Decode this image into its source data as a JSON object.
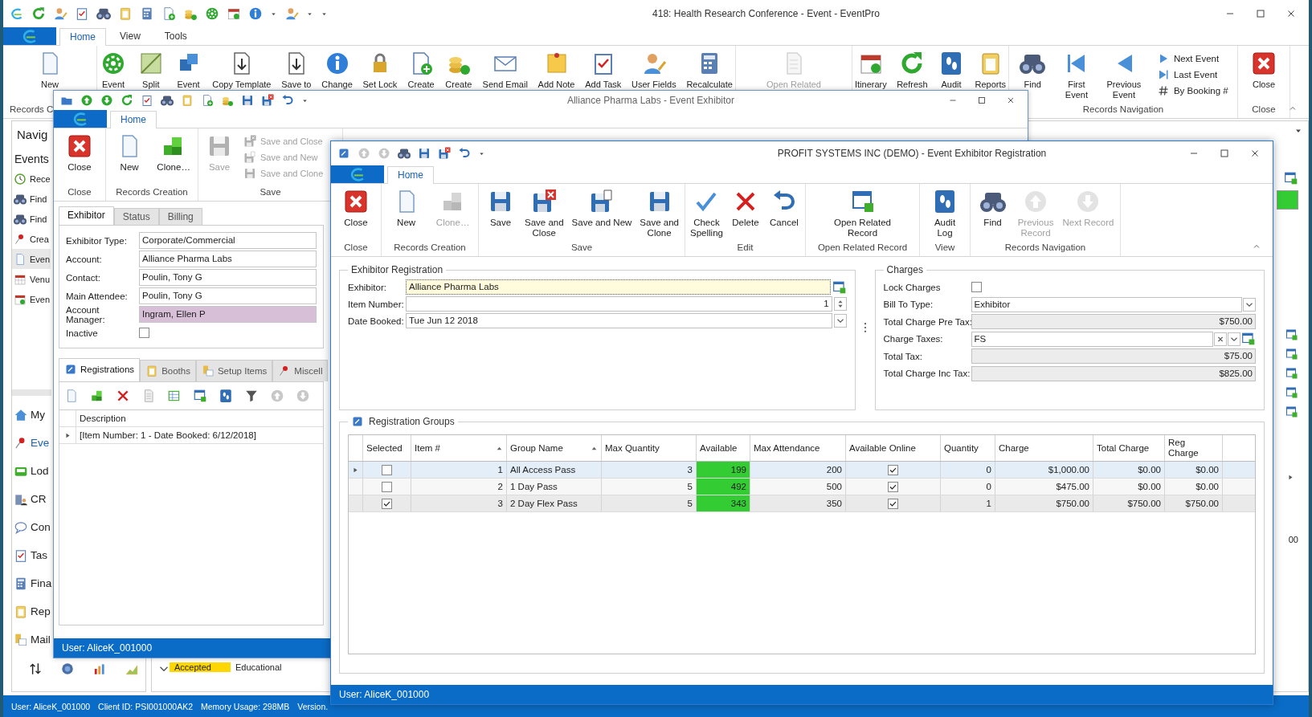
{
  "main_window": {
    "title": "418: Health Research Conference - Event - EventPro",
    "tabs": [
      {
        "label": "Home",
        "selected": true
      },
      {
        "label": "View",
        "selected": false
      },
      {
        "label": "Tools",
        "selected": false
      }
    ],
    "ribbon_groups": [
      {
        "label": "Records C",
        "buttons": [
          {
            "label": "New",
            "disabled": false
          }
        ]
      },
      {
        "buttons": [
          {
            "label": "Event",
            "disabled": false
          },
          {
            "label": "Split",
            "disabled": false
          },
          {
            "label": "Event",
            "disabled": false
          },
          {
            "label": "Copy Template",
            "disabled": false
          },
          {
            "label": "Save to",
            "disabled": false
          },
          {
            "label": "Change",
            "disabled": false
          },
          {
            "label": "Set Lock",
            "disabled": false
          },
          {
            "label": "Create",
            "disabled": false
          },
          {
            "label": "Create",
            "disabled": false
          },
          {
            "label": "Send Email",
            "disabled": false
          },
          {
            "label": "Add Note",
            "disabled": false
          },
          {
            "label": "Add Task",
            "disabled": false
          },
          {
            "label": "User Fields",
            "disabled": false
          },
          {
            "label": "Recalculate",
            "disabled": false
          }
        ]
      },
      {
        "buttons": [
          {
            "label": "Open Related",
            "disabled": true
          }
        ]
      },
      {
        "buttons": [
          {
            "label": "Itinerary",
            "disabled": false
          },
          {
            "label": "Refresh",
            "disabled": false
          },
          {
            "label": "Audit",
            "disabled": false
          },
          {
            "label": "Reports",
            "disabled": false
          }
        ]
      },
      {
        "label": "Records Navigation",
        "buttons": [
          {
            "label": "Find",
            "disabled": false
          },
          {
            "label": "First\nEvent",
            "disabled": false
          },
          {
            "label": "Previous\nEvent",
            "disabled": false
          }
        ],
        "small_buttons": [
          {
            "label": "Next Event",
            "disabled": false
          },
          {
            "label": "Last Event",
            "disabled": false
          },
          {
            "label": "By Booking #",
            "disabled": false
          }
        ]
      },
      {
        "label": "Close",
        "buttons": [
          {
            "label": "Close",
            "disabled": false
          }
        ]
      }
    ],
    "navigation": {
      "title": "Navig",
      "section": "Events",
      "items": [
        {
          "label": "Rece",
          "selected": false
        },
        {
          "label": "Find",
          "selected": false
        },
        {
          "label": "Find",
          "selected": false
        },
        {
          "label": "Crea",
          "selected": false
        },
        {
          "label": "Even",
          "selected": true
        },
        {
          "label": "Venu",
          "selected": false
        },
        {
          "label": "Even",
          "selected": false
        }
      ],
      "modules": [
        {
          "label": "My",
          "selected": false
        },
        {
          "label": "Eve",
          "selected": true
        },
        {
          "label": "Lod",
          "selected": false
        },
        {
          "label": "CR",
          "selected": false
        },
        {
          "label": "Con",
          "selected": false
        },
        {
          "label": "Tas",
          "selected": false
        },
        {
          "label": "Fina",
          "selected": false
        },
        {
          "label": "Rep",
          "selected": false
        },
        {
          "label": "Mail",
          "selected": false
        }
      ]
    },
    "background_cells": {
      "status": "Accepted",
      "type": "Educational",
      "amount": "00"
    },
    "status_bar": [
      "User: AliceK_001000",
      "Client ID: PSI001000AK2",
      "Memory Usage: 298MB",
      "Version."
    ]
  },
  "exhibitor_window": {
    "title": "Alliance Pharma Labs - Event Exhibitor",
    "tabs": [
      {
        "label": "Home",
        "selected": true
      }
    ],
    "ribbon_groups": [
      {
        "label": "Close",
        "buttons": [
          {
            "label": "Close",
            "disabled": false
          }
        ]
      },
      {
        "label": "Records Creation",
        "buttons": [
          {
            "label": "New",
            "disabled": false
          },
          {
            "label": "Clone…",
            "disabled": false
          }
        ]
      },
      {
        "label": "Save",
        "buttons": [
          {
            "label": "Save",
            "disabled": true
          }
        ],
        "small_buttons": [
          {
            "label": "Save and Close",
            "disabled": true
          },
          {
            "label": "Save and New",
            "disabled": true
          },
          {
            "label": "Save and Clone",
            "disabled": true
          }
        ]
      }
    ],
    "form_tabs": [
      {
        "label": "Exhibitor",
        "selected": true
      },
      {
        "label": "Status",
        "selected": false
      },
      {
        "label": "Billing",
        "selected": false
      }
    ],
    "fields": [
      {
        "label": "Exhibitor Type:",
        "value": "Corporate/Commercial",
        "highlighted": false
      },
      {
        "label": "Account:",
        "value": "Alliance Pharma Labs",
        "highlighted": false
      },
      {
        "label": "Contact:",
        "value": "Poulin, Tony G",
        "highlighted": false
      },
      {
        "label": "Main Attendee:",
        "value": "Poulin, Tony G",
        "highlighted": false
      },
      {
        "label": "Account Manager:",
        "value": "Ingram, Ellen P",
        "highlighted": true
      }
    ],
    "inactive": {
      "label": "Inactive",
      "checked": false
    },
    "detail_tabs": [
      {
        "label": "Registrations",
        "selected": true
      },
      {
        "label": "Booths",
        "selected": false
      },
      {
        "label": "Setup Items",
        "selected": false
      },
      {
        "label": "Miscell",
        "selected": false
      }
    ],
    "grid": {
      "columns": [
        "Description"
      ],
      "rows": [
        "[Item Number: 1 - Date Booked: 6/12/2018]"
      ]
    },
    "status_bar": "User: AliceK_001000"
  },
  "registration_window": {
    "title": "PROFIT SYSTEMS INC (DEMO) - Event Exhibitor Registration",
    "tabs": [
      {
        "label": "Home",
        "selected": true
      }
    ],
    "ribbon_groups": [
      {
        "label": "Close",
        "buttons": [
          {
            "label": "Close",
            "disabled": false
          }
        ]
      },
      {
        "label": "Records Creation",
        "buttons": [
          {
            "label": "New",
            "disabled": false
          },
          {
            "label": "Clone…",
            "disabled": true
          }
        ]
      },
      {
        "label": "Save",
        "buttons": [
          {
            "label": "Save",
            "disabled": false
          },
          {
            "label": "Save and\nClose",
            "disabled": false
          },
          {
            "label": "Save and New",
            "disabled": false
          },
          {
            "label": "Save and\nClone",
            "disabled": false
          }
        ]
      },
      {
        "label": "Edit",
        "buttons": [
          {
            "label": "Check\nSpelling",
            "disabled": false
          },
          {
            "label": "Delete",
            "disabled": false
          },
          {
            "label": "Cancel",
            "disabled": false
          }
        ]
      },
      {
        "label": "Open Related Record",
        "buttons": [
          {
            "label": "Open Related\nRecord",
            "disabled": false
          }
        ]
      },
      {
        "label": "View",
        "buttons": [
          {
            "label": "Audit\nLog",
            "disabled": false
          }
        ]
      },
      {
        "label": "Records Navigation",
        "buttons": [
          {
            "label": "Find",
            "disabled": false
          },
          {
            "label": "Previous\nRecord",
            "disabled": true
          },
          {
            "label": "Next Record",
            "disabled": true
          }
        ]
      }
    ],
    "exhibitor_registration": {
      "title": "Exhibitor Registration",
      "exhibitor": {
        "label": "Exhibitor:",
        "value": "Alliance Pharma Labs"
      },
      "item_number": {
        "label": "Item Number:",
        "value": "1"
      },
      "date_booked": {
        "label": "Date Booked:",
        "value": "Tue Jun 12 2018"
      }
    },
    "charges": {
      "title": "Charges",
      "lock_charges": {
        "label": "Lock Charges",
        "checked": false
      },
      "bill_to_type": {
        "label": "Bill To Type:",
        "value": "Exhibitor"
      },
      "total_charge_pre_tax": {
        "label": "Total Charge Pre Tax:",
        "value": "$750.00"
      },
      "charge_taxes": {
        "label": "Charge Taxes:",
        "value": "FS"
      },
      "total_tax": {
        "label": "Total Tax:",
        "value": "$75.00"
      },
      "total_charge_inc_tax": {
        "label": "Total Charge Inc Tax:",
        "value": "$825.00"
      }
    },
    "registration_groups": {
      "title": "Registration Groups",
      "columns": [
        {
          "label": "Selected",
          "sorted": false
        },
        {
          "label": "Item #",
          "sorted": true
        },
        {
          "label": "Group Name",
          "sorted": true
        },
        {
          "label": "Max Quantity",
          "sorted": false
        },
        {
          "label": "Available",
          "sorted": false
        },
        {
          "label": "Max Attendance",
          "sorted": false
        },
        {
          "label": "Available Online",
          "sorted": false
        },
        {
          "label": "Quantity",
          "sorted": false
        },
        {
          "label": "Charge",
          "sorted": false
        },
        {
          "label": "Total Charge",
          "sorted": false
        },
        {
          "label": "Reg\nCharge",
          "sorted": false
        }
      ],
      "rows": [
        {
          "selected": true,
          "checked": false,
          "item": "1",
          "group_name": "All Access Pass",
          "max_quantity": "3",
          "available": "199",
          "max_attendance": "200",
          "available_online": true,
          "quantity": "0",
          "charge": "$1,000.00",
          "total_charge": "$0.00",
          "reg_charge": "$0.00"
        },
        {
          "selected": false,
          "checked": false,
          "item": "2",
          "group_name": "1 Day Pass",
          "max_quantity": "5",
          "available": "492",
          "max_attendance": "500",
          "available_online": true,
          "quantity": "0",
          "charge": "$475.00",
          "total_charge": "$0.00",
          "reg_charge": "$0.00"
        },
        {
          "selected": false,
          "checked": true,
          "item": "3",
          "group_name": "2 Day Flex Pass",
          "max_quantity": "5",
          "available": "343",
          "max_attendance": "350",
          "available_online": true,
          "quantity": "1",
          "charge": "$750.00",
          "total_charge": "$750.00",
          "reg_charge": "$750.00"
        }
      ]
    },
    "status_bar": "User: AliceK_001000"
  }
}
